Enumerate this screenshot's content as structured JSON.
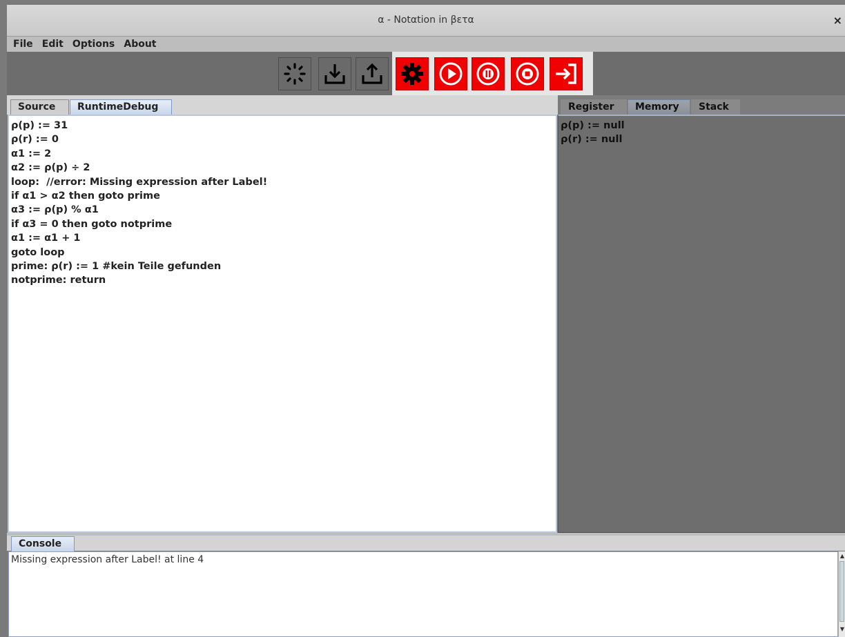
{
  "window": {
    "title": "α - Notαtion in βετα",
    "close_glyph": "×"
  },
  "menu": [
    "File",
    "Edit",
    "Options",
    "About"
  ],
  "toolbar": {
    "buttons": [
      {
        "icon": "loading-spinner-icon"
      },
      {
        "icon": "download-icon"
      },
      {
        "icon": "upload-icon"
      },
      {
        "icon": "gear-icon"
      },
      {
        "icon": "play-circle-icon"
      },
      {
        "icon": "pause-circle-icon"
      },
      {
        "icon": "stop-circle-icon"
      },
      {
        "icon": "step-into-icon"
      }
    ],
    "accent_color": "#f00000"
  },
  "editor_tabs": [
    "Source",
    "RuntimeDebug"
  ],
  "editor_tab_active": "RuntimeDebug",
  "editor_lines": [
    "ρ(p) := 31",
    "ρ(r) := 0",
    "α1 := 2",
    "α2 := ρ(p) ÷ 2",
    "loop:  //error: Missing expression after Label!",
    "if α1 > α2 then goto prime",
    "α3 := ρ(p) % α1",
    "if α3 = 0 then goto notprime",
    "α1 := α1 + 1",
    "goto loop",
    "prime: ρ(r) := 1 #kein Teile gefunden",
    "notprime: return"
  ],
  "side_tabs": [
    "Register",
    "Memory",
    "Stack"
  ],
  "side_tab_active": "Memory",
  "memory_lines": [
    "ρ(p) := null",
    "ρ(r) := null"
  ],
  "console": {
    "tab": "Console",
    "text": "Missing expression after Label! at line 4"
  }
}
